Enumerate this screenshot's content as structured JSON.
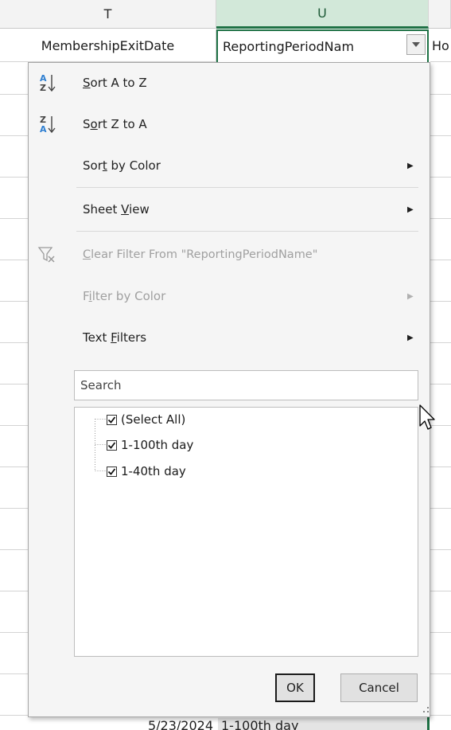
{
  "columns": {
    "t": "T",
    "u": "U"
  },
  "header_row": {
    "t": "MembershipExitDate",
    "u": "ReportingPeriodNam",
    "v": "Ho"
  },
  "menu": {
    "sort_az": "Sort A to Z",
    "sort_za": "Sort Z to A",
    "sort_by_color": "Sort by Color",
    "sheet_view": "Sheet View",
    "clear_filter": "Clear Filter From \"ReportingPeriodName\"",
    "filter_by_color": "Filter by Color",
    "text_filters": "Text Filters"
  },
  "search": {
    "placeholder": "Search"
  },
  "filter_values": [
    {
      "label": "(Select All)",
      "checked": true
    },
    {
      "label": "1-100th day",
      "checked": true
    },
    {
      "label": "1-40th day",
      "checked": true
    }
  ],
  "buttons": {
    "ok": "OK",
    "cancel": "Cancel"
  },
  "bottom_row": {
    "t": "5/23/2024",
    "u": "1-100th day"
  },
  "colors": {
    "excel_green": "#1e7145",
    "selected_header": "#d2e8d9"
  },
  "icons": [
    "sort-ascending-icon",
    "sort-descending-icon",
    "clear-filter-icon",
    "submenu-arrow-icon",
    "filter-dropdown-icon",
    "mouse-cursor-icon"
  ]
}
